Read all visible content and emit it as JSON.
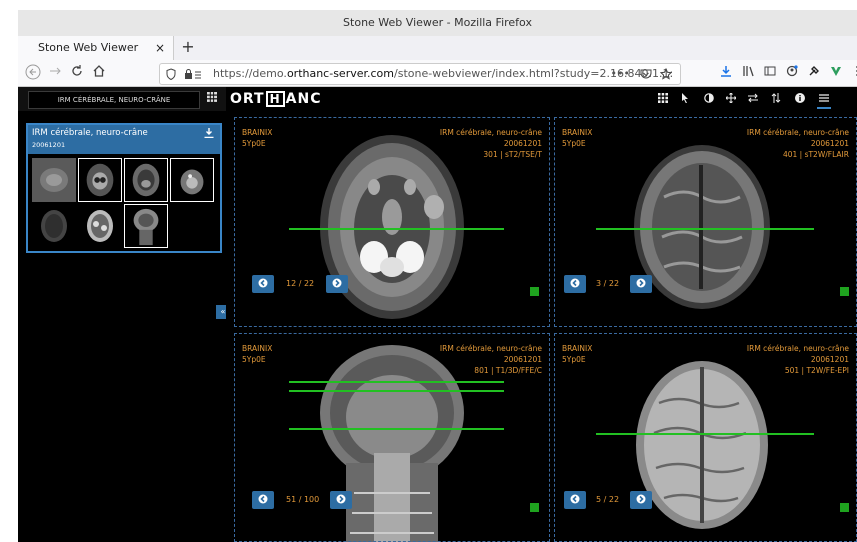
{
  "browser": {
    "window_title": "Stone Web Viewer - Mozilla Firefox",
    "tab_label": "Stone Web Viewer",
    "tab_close": "×",
    "new_tab": "+",
    "url_prefix": "https://demo.",
    "url_host": "orthanc-server.com",
    "url_rest": "/stone-webviewer/index.html?study=2.16.840.1.1:",
    "url_more": "•••"
  },
  "sidebar": {
    "study_button": "IRM CÉRÉBRALE, NEURO-CRÂNE",
    "card_title": "IRM cérébrale, neuro-crâne",
    "card_date": "20061201",
    "collapse_label": "«"
  },
  "viewer": {
    "logo_left": "ORT",
    "logo_mid": "H",
    "logo_right": "ANC",
    "panes": [
      {
        "patient": "BRAINIX",
        "patient_id": "5Yp0E",
        "study": "IRM cérébrale, neuro-crâne",
        "date": "20061201",
        "series": "301 | sT2/TSE/T",
        "counter": "12 / 22"
      },
      {
        "patient": "BRAINIX",
        "patient_id": "5Yp0E",
        "study": "IRM cérébrale, neuro-crâne",
        "date": "20061201",
        "series": "401 | sT2W/FLAIR",
        "counter": "3 / 22"
      },
      {
        "patient": "BRAINIX",
        "patient_id": "5Yp0E",
        "study": "IRM cérébrale, neuro-crâne",
        "date": "20061201",
        "series": "801 | T1/3D/FFE/C",
        "counter": "51 / 100"
      },
      {
        "patient": "BRAINIX",
        "patient_id": "5Yp0E",
        "study": "IRM cérébrale, neuro-crâne",
        "date": "20061201",
        "series": "501 | T2W/FE-EPI",
        "counter": "5 / 22"
      }
    ]
  },
  "colors": {
    "accent": "#2d6da3",
    "overlay_text": "#e39a3a",
    "reference_line": "#22c022"
  }
}
